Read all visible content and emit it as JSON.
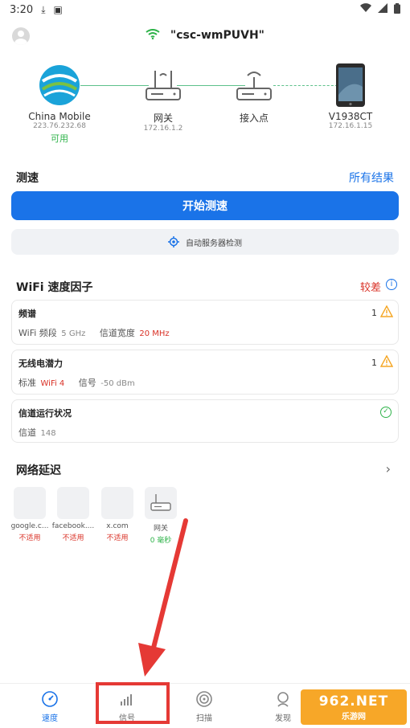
{
  "status_bar": {
    "time": "3:20"
  },
  "header": {
    "ssid": "\"csc-wmPUVH\""
  },
  "topology": {
    "isp": {
      "name": "China Mobile",
      "ip": "223.76.232.68",
      "status": "可用"
    },
    "gateway": {
      "name": "网关",
      "ip": "172.16.1.2"
    },
    "access_point": {
      "name": "接入点"
    },
    "device": {
      "name": "V1938CT",
      "ip": "172.16.1.15"
    }
  },
  "speed_test": {
    "title": "测速",
    "all_results": "所有结果",
    "start_button": "开始测速",
    "auto_detect": "自动服务器检测"
  },
  "wifi_factors": {
    "title": "WiFi 速度因子",
    "rating": "较差",
    "info": "i",
    "cards": [
      {
        "title": "频谱",
        "count": "1",
        "rows": [
          {
            "label": "WiFi 频段",
            "value": "5 GHz"
          },
          {
            "label": "信道宽度",
            "value": "20 MHz"
          }
        ]
      },
      {
        "title": "无线电潜力",
        "count": "1",
        "rows": [
          {
            "label": "标准",
            "value": "WiFi 4"
          },
          {
            "label": "信号",
            "value": "-50 dBm"
          }
        ]
      },
      {
        "title": "信道运行状况",
        "rows": [
          {
            "label": "信道",
            "value": "148"
          }
        ]
      }
    ],
    "colors": {
      "warning": "#f5a623",
      "bad": "#d93025",
      "good": "#2fb34a"
    }
  },
  "latency": {
    "title": "网络延迟",
    "items": [
      {
        "name": "google.c...",
        "status": "不适用"
      },
      {
        "name": "facebook....",
        "status": "不适用"
      },
      {
        "name": "x.com",
        "status": "不适用"
      },
      {
        "name": "网关",
        "status": "0 毫秒"
      }
    ]
  },
  "bottom_nav": {
    "items": [
      {
        "label": "速度",
        "icon": "speedometer-icon"
      },
      {
        "label": "信号",
        "icon": "signal-bars-icon"
      },
      {
        "label": "扫描",
        "icon": "scan-icon"
      },
      {
        "label": "发现",
        "icon": "discover-icon"
      }
    ]
  },
  "watermark": {
    "line1": "962.NET",
    "line2": "乐游网"
  }
}
